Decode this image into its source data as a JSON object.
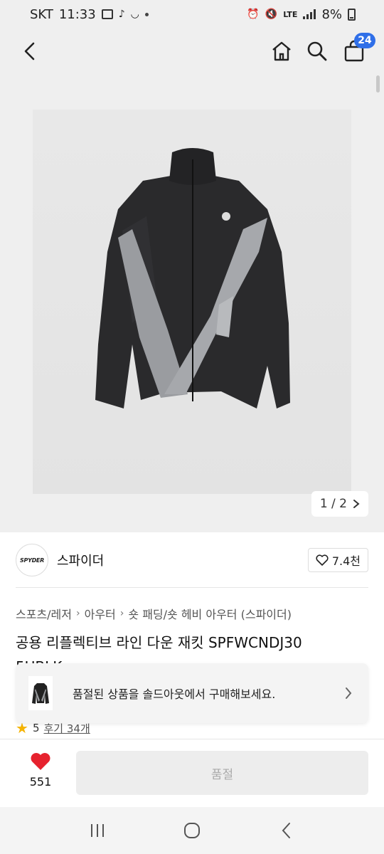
{
  "status_bar": {
    "carrier": "SKT",
    "time": "11:33",
    "network": "LTE",
    "battery": "8%"
  },
  "header": {
    "cart_count": "24"
  },
  "gallery": {
    "pager": "1 / 2"
  },
  "brand": {
    "logo_text": "SPYDER",
    "name": "스파이더",
    "likes": "7.4천"
  },
  "breadcrumb": [
    "스포츠/레저",
    "아우터",
    "숏 패딩/숏 헤비 아우터 (스파이더)"
  ],
  "product": {
    "title_line1": "공용 리플렉티브 라인 다운 재킷 SPFWCNDJ30",
    "title_line2": "5UBLK"
  },
  "soldout_banner": {
    "text": "품절된 상품을 솔드아웃에서 구매해보세요."
  },
  "rating": {
    "score": "5",
    "reviews": "후기 34개"
  },
  "action_bar": {
    "wish_count": "551",
    "buy_label": "품절"
  },
  "colors": {
    "accent_blue": "#2f6fe8",
    "heart_red": "#e6222e",
    "star_yellow": "#f5b301"
  }
}
